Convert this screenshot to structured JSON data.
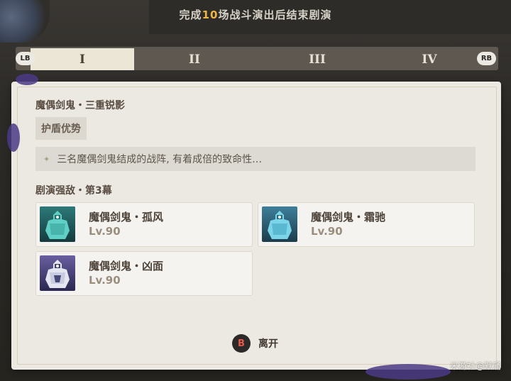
{
  "banner": {
    "prefix": "完成",
    "count": "10",
    "suffix": "场战斗演出后结束剧演"
  },
  "tabs": {
    "left_shoulder": "LB",
    "right_shoulder": "RB",
    "items": [
      {
        "label": "I",
        "active": true
      },
      {
        "label": "II",
        "active": false
      },
      {
        "label": "III",
        "active": false
      },
      {
        "label": "IV",
        "active": false
      }
    ]
  },
  "stage": {
    "title": "魔偶剑鬼・三重锐影",
    "tag": "护盾优势",
    "description": "三名魔偶剑鬼结成的战阵, 有着成倍的致命性…"
  },
  "enemies": {
    "section_title": "剧演强敌・第3幕",
    "items": [
      {
        "name": "魔偶剑鬼・孤风",
        "level": "Lv.90",
        "portrait_icon": "ruin-grader-teal-icon"
      },
      {
        "name": "魔偶剑鬼・霜驰",
        "level": "Lv.90",
        "portrait_icon": "ruin-grader-cyan-icon"
      },
      {
        "name": "魔偶剑鬼・凶面",
        "level": "Lv.90",
        "portrait_icon": "ruin-grader-white-icon"
      }
    ]
  },
  "footer": {
    "button_key": "B",
    "leave_label": "离开"
  },
  "watermark": "米游社@默涌",
  "colors": {
    "accent": "#f0b545",
    "panel": "#ece9e3",
    "tab_bar": "#5e5850",
    "close_key": "#e55a4a"
  }
}
